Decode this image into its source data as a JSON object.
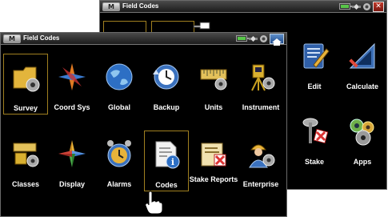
{
  "back_window": {
    "menu_label": "M",
    "title": "Field Codes",
    "items": [
      {
        "label": "Edit",
        "icon": "edit-icon"
      },
      {
        "label": "Calculate",
        "icon": "calculate-icon"
      },
      {
        "label": "Stake",
        "icon": "stake-icon"
      },
      {
        "label": "Apps",
        "icon": "apps-icon"
      }
    ]
  },
  "front_window": {
    "menu_label": "M",
    "title": "Field Codes",
    "items": [
      {
        "label": "Survey",
        "icon": "survey-icon",
        "selected": true
      },
      {
        "label": "Coord Sys",
        "icon": "coord-sys-icon"
      },
      {
        "label": "Global",
        "icon": "global-icon"
      },
      {
        "label": "Backup",
        "icon": "backup-icon"
      },
      {
        "label": "Units",
        "icon": "units-icon"
      },
      {
        "label": "Instrument",
        "icon": "instrument-icon"
      },
      {
        "label": "Classes",
        "icon": "classes-icon"
      },
      {
        "label": "Display",
        "icon": "display-icon"
      },
      {
        "label": "Alarms",
        "icon": "alarms-icon"
      },
      {
        "label": "Codes",
        "icon": "codes-icon",
        "selected": true
      },
      {
        "label": "Stake Reports",
        "icon": "stake-reports-icon"
      },
      {
        "label": "Enterprise",
        "icon": "enterprise-icon"
      }
    ]
  },
  "colors": {
    "background": "#000000",
    "selection_border": "#a08020",
    "label": "#ffffff"
  }
}
